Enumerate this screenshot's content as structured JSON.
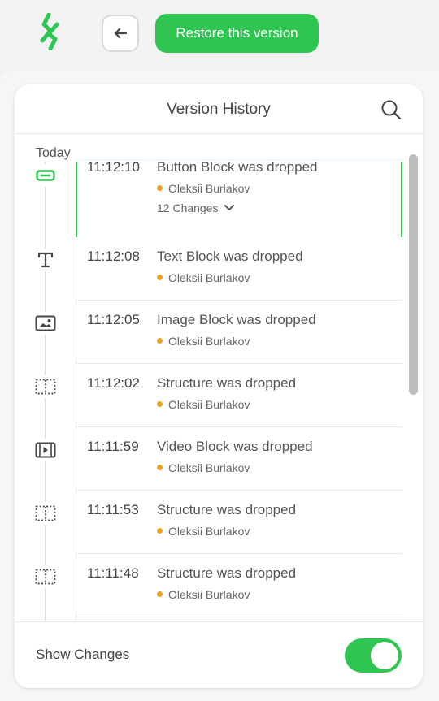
{
  "toolbar": {
    "restore_label": "Restore this version"
  },
  "panel": {
    "title": "Version History",
    "group_label": "Today",
    "versions": [
      {
        "time": "11:12:10",
        "title": "Button Block was dropped",
        "author": "Oleksii Burlakov",
        "changes": "12 Changes",
        "icon": "button-block-icon",
        "selected": true
      },
      {
        "time": "11:12:08",
        "title": "Text Block was dropped",
        "author": "Oleksii Burlakov",
        "icon": "text-block-icon"
      },
      {
        "time": "11:12:05",
        "title": "Image Block was dropped",
        "author": "Oleksii Burlakov",
        "icon": "image-block-icon"
      },
      {
        "time": "11:12:02",
        "title": "Structure was dropped",
        "author": "Oleksii Burlakov",
        "icon": "structure-icon"
      },
      {
        "time": "11:11:59",
        "title": "Video Block was dropped",
        "author": "Oleksii Burlakov",
        "icon": "video-block-icon"
      },
      {
        "time": "11:11:53",
        "title": "Structure was dropped",
        "author": "Oleksii Burlakov",
        "icon": "structure-icon"
      },
      {
        "time": "11:11:48",
        "title": "Structure was dropped",
        "author": "Oleksii Burlakov",
        "icon": "structure-icon"
      }
    ]
  },
  "footer": {
    "show_changes_label": "Show Changes",
    "show_changes_on": true
  },
  "colors": {
    "accent": "#2ec650",
    "author_dot": "#f0a020"
  }
}
